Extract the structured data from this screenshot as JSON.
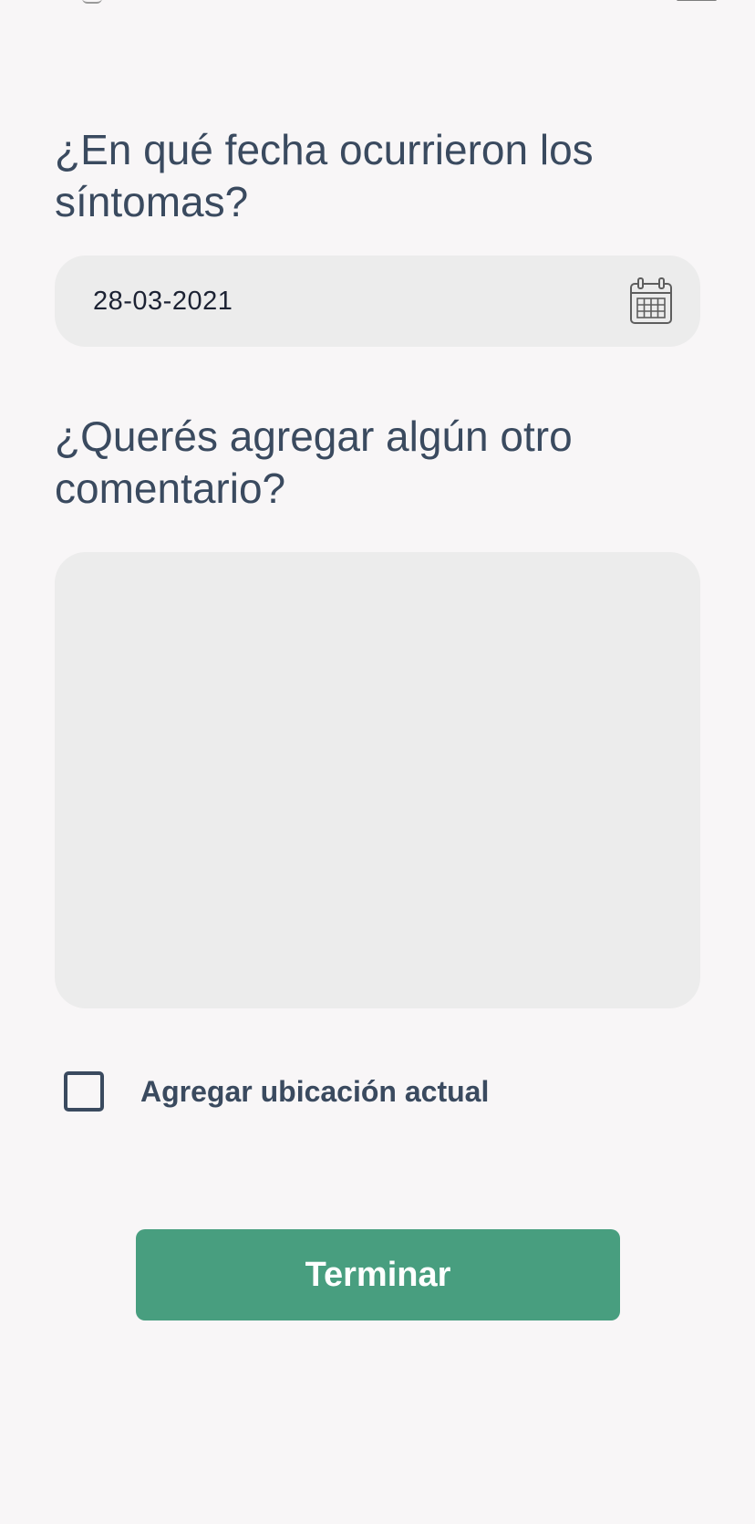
{
  "form": {
    "date_question": "¿En qué fecha ocurrieron los síntomas?",
    "date_value": "28-03-2021",
    "comment_question": "¿Querés agregar algún otro comentario?",
    "comment_value": "",
    "location_checkbox_label": "Agregar ubicación actual",
    "location_checked": false,
    "submit_label": "Terminar"
  },
  "icons": {
    "date_picker": "calendar-icon"
  },
  "colors": {
    "background": "#f8f6f7",
    "text": "#3a4a5f",
    "field_background": "#ececec",
    "primary_button": "#489e7f"
  }
}
